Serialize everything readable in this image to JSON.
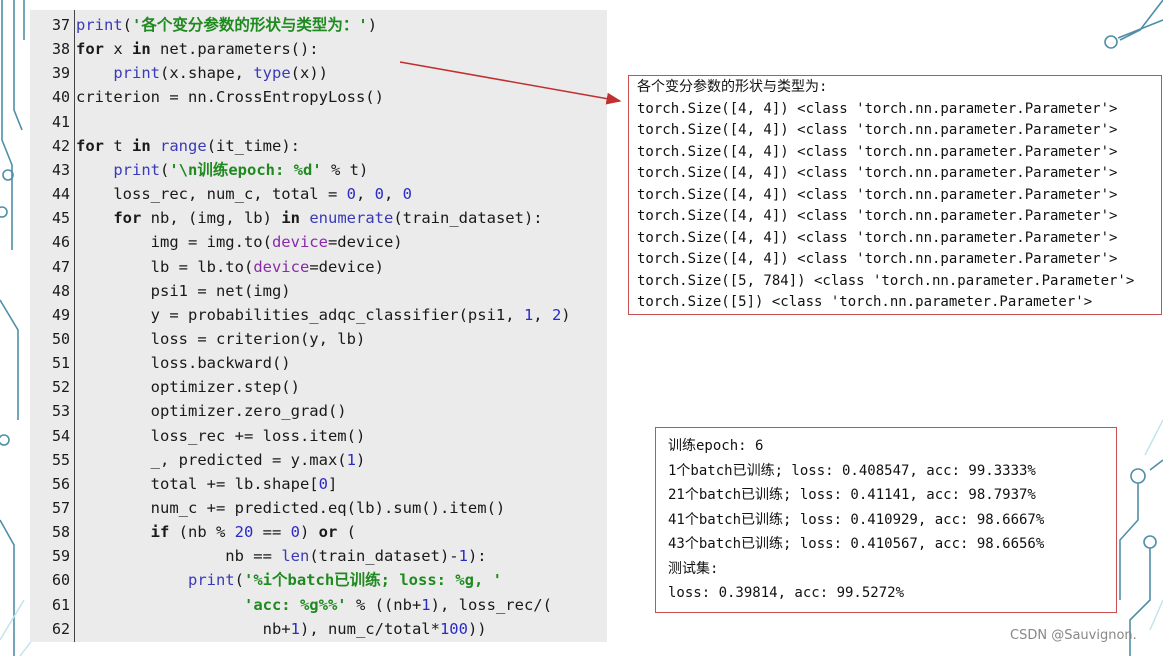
{
  "code": {
    "lines": [
      {
        "n": "37",
        "tokens": [
          [
            "bi",
            "print"
          ],
          [
            "",
            "("
          ],
          [
            "str",
            "'各个变分参数的形状与类型为：'"
          ],
          [
            "",
            ")"
          ]
        ]
      },
      {
        "n": "38",
        "tokens": [
          [
            "kw",
            "for"
          ],
          [
            "",
            " x "
          ],
          [
            "kw",
            "in"
          ],
          [
            "",
            " net.parameters():"
          ]
        ]
      },
      {
        "n": "39",
        "tokens": [
          [
            "",
            "    "
          ],
          [
            "bi",
            "print"
          ],
          [
            "",
            "(x.shape, "
          ],
          [
            "bi",
            "type"
          ],
          [
            "",
            "(x))"
          ]
        ]
      },
      {
        "n": "40",
        "tokens": [
          [
            "",
            "criterion = nn.CrossEntropyLoss()"
          ]
        ]
      },
      {
        "n": "41",
        "tokens": []
      },
      {
        "n": "42",
        "tokens": [
          [
            "kw",
            "for"
          ],
          [
            "",
            " t "
          ],
          [
            "kw",
            "in"
          ],
          [
            "",
            " "
          ],
          [
            "bi",
            "range"
          ],
          [
            "",
            "(it_time):"
          ]
        ]
      },
      {
        "n": "43",
        "tokens": [
          [
            "",
            "    "
          ],
          [
            "bi",
            "print"
          ],
          [
            "",
            "("
          ],
          [
            "str",
            "'\\n训练epoch: %d'"
          ],
          [
            "",
            " % t)"
          ]
        ]
      },
      {
        "n": "44",
        "tokens": [
          [
            "",
            "    loss_rec, num_c, total = "
          ],
          [
            "num",
            "0"
          ],
          [
            "",
            ", "
          ],
          [
            "num",
            "0"
          ],
          [
            "",
            ", "
          ],
          [
            "num",
            "0"
          ]
        ]
      },
      {
        "n": "45",
        "tokens": [
          [
            "",
            "    "
          ],
          [
            "kw",
            "for"
          ],
          [
            "",
            " nb, (img, lb) "
          ],
          [
            "kw",
            "in"
          ],
          [
            "",
            " "
          ],
          [
            "bi",
            "enumerate"
          ],
          [
            "",
            "(train_dataset):"
          ]
        ]
      },
      {
        "n": "46",
        "tokens": [
          [
            "",
            "        img = img.to("
          ],
          [
            "arg",
            "device"
          ],
          [
            "",
            "=device)"
          ]
        ]
      },
      {
        "n": "47",
        "tokens": [
          [
            "",
            "        lb = lb.to("
          ],
          [
            "arg",
            "device"
          ],
          [
            "",
            "=device)"
          ]
        ]
      },
      {
        "n": "48",
        "tokens": [
          [
            "",
            "        psi1 = net(img)"
          ]
        ]
      },
      {
        "n": "49",
        "tokens": [
          [
            "",
            "        y = probabilities_adqc_classifier(psi1, "
          ],
          [
            "num",
            "1"
          ],
          [
            "",
            ", "
          ],
          [
            "num",
            "2"
          ],
          [
            "",
            ")"
          ]
        ]
      },
      {
        "n": "50",
        "tokens": [
          [
            "",
            "        loss = criterion(y, lb)"
          ]
        ]
      },
      {
        "n": "51",
        "tokens": [
          [
            "",
            "        loss.backward()"
          ]
        ]
      },
      {
        "n": "52",
        "tokens": [
          [
            "",
            "        optimizer.step()"
          ]
        ]
      },
      {
        "n": "53",
        "tokens": [
          [
            "",
            "        optimizer.zero_grad()"
          ]
        ]
      },
      {
        "n": "54",
        "tokens": [
          [
            "",
            "        loss_rec += loss.item()"
          ]
        ]
      },
      {
        "n": "55",
        "tokens": [
          [
            "",
            "        _, predicted = y.max("
          ],
          [
            "num",
            "1"
          ],
          [
            "",
            ")"
          ]
        ]
      },
      {
        "n": "56",
        "tokens": [
          [
            "",
            "        total += lb.shape["
          ],
          [
            "num",
            "0"
          ],
          [
            "",
            "]"
          ]
        ]
      },
      {
        "n": "57",
        "tokens": [
          [
            "",
            "        num_c += predicted.eq(lb).sum().item()"
          ]
        ]
      },
      {
        "n": "58",
        "tokens": [
          [
            "",
            "        "
          ],
          [
            "kw",
            "if"
          ],
          [
            "",
            " (nb % "
          ],
          [
            "num",
            "20"
          ],
          [
            "",
            " == "
          ],
          [
            "num",
            "0"
          ],
          [
            "",
            ") "
          ],
          [
            "kw",
            "or"
          ],
          [
            "",
            " ("
          ]
        ]
      },
      {
        "n": "59",
        "tokens": [
          [
            "",
            "                nb == "
          ],
          [
            "bi",
            "len"
          ],
          [
            "",
            "(train_dataset)-"
          ],
          [
            "num",
            "1"
          ],
          [
            "",
            "):"
          ]
        ]
      },
      {
        "n": "60",
        "tokens": [
          [
            "",
            "            "
          ],
          [
            "bi",
            "print"
          ],
          [
            "",
            "("
          ],
          [
            "str",
            "'%i个batch已训练; loss: %g, '"
          ]
        ]
      },
      {
        "n": "61",
        "tokens": [
          [
            "",
            "                  "
          ],
          [
            "str",
            "'acc: %g%%'"
          ],
          [
            "",
            " % ((nb+"
          ],
          [
            "num",
            "1"
          ],
          [
            "",
            "), loss_rec/("
          ]
        ]
      },
      {
        "n": "62",
        "tokens": [
          [
            "",
            "                    nb+"
          ],
          [
            "num",
            "1"
          ],
          [
            "",
            "), num_c/total*"
          ],
          [
            "num",
            "100"
          ],
          [
            "",
            "))"
          ]
        ]
      }
    ]
  },
  "output_params": {
    "lines": [
      "各个变分参数的形状与类型为:",
      "torch.Size([4, 4]) <class 'torch.nn.parameter.Parameter'>",
      "torch.Size([4, 4]) <class 'torch.nn.parameter.Parameter'>",
      "torch.Size([4, 4]) <class 'torch.nn.parameter.Parameter'>",
      "torch.Size([4, 4]) <class 'torch.nn.parameter.Parameter'>",
      "torch.Size([4, 4]) <class 'torch.nn.parameter.Parameter'>",
      "torch.Size([4, 4]) <class 'torch.nn.parameter.Parameter'>",
      "torch.Size([4, 4]) <class 'torch.nn.parameter.Parameter'>",
      "torch.Size([4, 4]) <class 'torch.nn.parameter.Parameter'>",
      "torch.Size([5, 784]) <class 'torch.nn.parameter.Parameter'>",
      "torch.Size([5]) <class 'torch.nn.parameter.Parameter'>"
    ]
  },
  "output_train": {
    "lines": [
      "训练epoch: 6",
      "1个batch已训练; loss: 0.408547, acc: 99.3333%",
      "21个batch已训练; loss: 0.41141, acc: 98.7937%",
      "41个batch已训练; loss: 0.410929, acc: 98.6667%",
      "43个batch已训练; loss: 0.410567, acc: 98.6656%",
      "测试集:",
      "loss: 0.39814, acc: 99.5272%"
    ]
  },
  "watermark": "CSDN @Sauvignon.",
  "colors": {
    "arrow": "#c03030",
    "box_border": "#c85050",
    "decor": "#4a8aa0"
  }
}
